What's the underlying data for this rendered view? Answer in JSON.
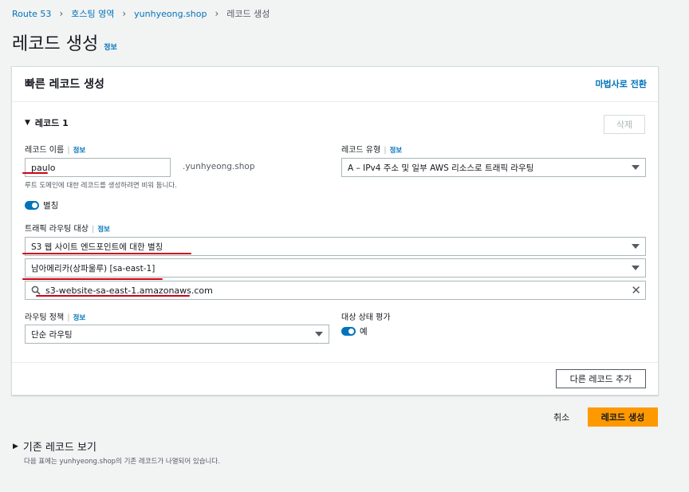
{
  "breadcrumb": {
    "items": [
      "Route 53",
      "호스팅 영역",
      "yunhyeong.shop"
    ],
    "current": "레코드 생성"
  },
  "page": {
    "title": "레코드 생성",
    "info": "정보"
  },
  "panel": {
    "title": "빠른 레코드 생성",
    "wizard_link": "마법사로 전환",
    "record_section": "레코드 1",
    "delete_button": "삭제",
    "record_name": {
      "label": "레코드 이름",
      "info": "정보",
      "value": "paulo",
      "suffix": ".yunhyeong.shop",
      "hint": "루트 도메인에 대한 레코드를 생성하려면 비워 둡니다."
    },
    "record_type": {
      "label": "레코드 유형",
      "info": "정보",
      "value": "A – IPv4 주소 및 일부 AWS 리소스로 트래픽 라우팅"
    },
    "alias": {
      "label": "별칭",
      "enabled": true
    },
    "routing_target": {
      "label": "트래픽 라우팅 대상",
      "info": "정보",
      "endpoint": "S3 웹 사이트 엔드포인트에 대한 별칭",
      "region": "남아메리카(상파울루) [sa-east-1]",
      "search_value": "s3-website-sa-east-1.amazonaws.com"
    },
    "routing_policy": {
      "label": "라우팅 정책",
      "info": "정보",
      "value": "단순 라우팅"
    },
    "health_eval": {
      "label": "대상 상태 평가",
      "value": "예",
      "enabled": true
    },
    "add_record_button": "다른 레코드 추가"
  },
  "actions": {
    "cancel": "취소",
    "create": "레코드 생성"
  },
  "existing": {
    "title": "기존 레코드 보기",
    "description": "다음 표에는 yunhyeong.shop의 기존 레코드가 나열되어 있습니다."
  },
  "colors": {
    "accent": "#0073bb",
    "primary_button": "#ff9900",
    "annotation": "#d0021b"
  }
}
